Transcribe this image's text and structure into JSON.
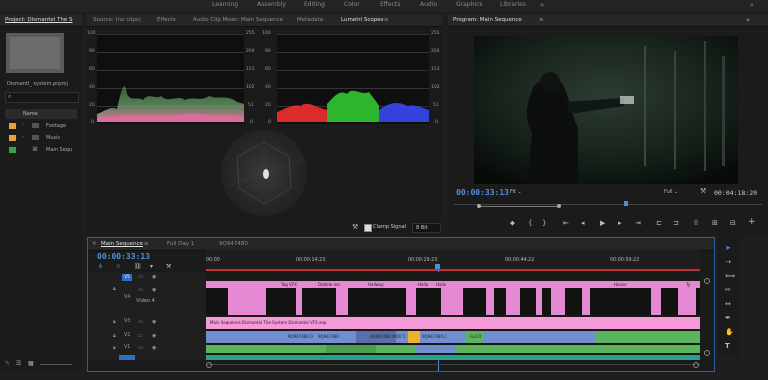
{
  "workspaces": [
    "Learning",
    "Assembly",
    "Editing",
    "Color",
    "Effects",
    "Audio",
    "Graphics",
    "Libraries"
  ],
  "project": {
    "tab": "Project: Dismantel The S",
    "filename": "Dismantl_ system.prproj",
    "search_placeholder": "",
    "col_name": "Name",
    "items": [
      {
        "label": "Footage",
        "color": "#e8a33c"
      },
      {
        "label": "Music",
        "color": "#e8a33c"
      },
      {
        "label": "Main Sequ",
        "color": "#3aa04a"
      }
    ]
  },
  "source": {
    "tabs": [
      "Source: (no clips)",
      "Effects",
      "Audio Clip Mixer: Main Sequence",
      "Metadata",
      "Lumetri Scopes"
    ],
    "active_tab": "Lumetri Scopes",
    "waveform_left_ticks": [
      "100",
      "80",
      "60",
      "40",
      "20",
      "0"
    ],
    "waveform_right_ticks": [
      "255",
      "204",
      "153",
      "102",
      "51",
      "0"
    ],
    "parade_left_ticks": [
      "100",
      "80",
      "60",
      "40",
      "20",
      "0"
    ],
    "parade_right_ticks": [
      "255",
      "204",
      "153",
      "102",
      "51",
      "0"
    ],
    "clamp_signal": "Clamp Signal",
    "bit_depth": "8 Bit"
  },
  "program": {
    "tab": "Program: Main Sequence",
    "timecode": "00:00:33:13",
    "fit": "Fit",
    "quality": "Full",
    "duration": "00:04:18:20"
  },
  "timeline": {
    "tabs": [
      "Main Sequence",
      "Full Day 1",
      "9Q947480"
    ],
    "timecode": "00:00:33:13",
    "ruler": [
      "00:00",
      "00:00:14:23",
      "00:00:29:23",
      "00:00:44:22",
      "00:00:59:22"
    ],
    "tracks": [
      "V5",
      "V4",
      "V3",
      "V2",
      "V1"
    ],
    "track_v4_name": "Video 4",
    "clip_v3": "Main Sequence:Dismantel The System Dismantel VFX.aep",
    "v5_clips": [
      "Tag VFX",
      "Dobble mo",
      "Hallway",
      "Hallo",
      "Hallu",
      "House",
      "Ty"
    ],
    "v2_clips": [
      "9Q947480.0",
      "9Q947480",
      "9Q947480.MOV C",
      "9Q947480.C",
      "Full D"
    ]
  },
  "colors": {
    "accent_blue": "#2d8ceb",
    "clip_pink": "#e58ad2",
    "clip_pink_light": "#f59ad8",
    "clip_blue": "#6f8fd1",
    "clip_green": "#5ab45a",
    "playhead": "#4b8ee0"
  }
}
